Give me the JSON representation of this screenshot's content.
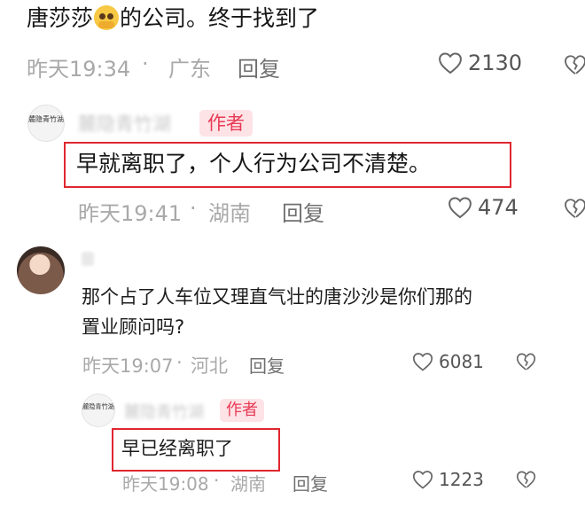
{
  "comment1": {
    "text_before": "唐莎莎",
    "text_after": "的公司。终于找到了",
    "emoji": "pleading-face-emoji",
    "time": "昨天19:34",
    "sep": "·",
    "location": "广东",
    "reply": "回复",
    "likes": "2130"
  },
  "reply1": {
    "author_blur": "麓隐青竹湖",
    "author_tag": "作者",
    "avatar_text": "麓隐青竹湖",
    "text": "早就离职了，个人行为公司不清楚。",
    "time": "昨天19:41",
    "sep": "·",
    "location": "湖南",
    "reply": "回复",
    "likes": "474"
  },
  "comment2": {
    "line1": "那个占了人车位又理直气壮的唐沙沙是你们那的",
    "line2": "置业顾问吗?",
    "time": "昨天19:07",
    "sep": "·",
    "location": "河北",
    "reply": "回复",
    "likes": "6081"
  },
  "reply2": {
    "author_blur": "麓隐青竹湖",
    "author_tag": "作者",
    "avatar_text": "麓隐青竹湖",
    "text": "早已经离职了",
    "time": "昨天19:08",
    "sep": "·",
    "location": "湖南",
    "reply": "回复",
    "likes": "1223"
  },
  "colors": {
    "highlight_border": "#e0262f",
    "author_tag_bg": "#fde3e6",
    "author_tag_text": "#e83a55",
    "meta_text": "#a9a9a9"
  }
}
